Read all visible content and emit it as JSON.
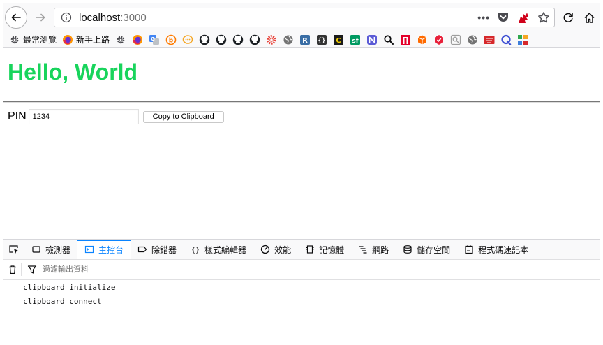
{
  "browser": {
    "url_host": "localhost",
    "url_port": ":3000"
  },
  "bookmarks": [
    {
      "name": "most-visited",
      "label": "最常瀏覽",
      "icon": "gear-icon",
      "color": "#4a4a4f"
    },
    {
      "name": "getting-started",
      "label": "新手上路",
      "icon": "firefox-icon",
      "color": "#e66000"
    },
    {
      "name": "settings",
      "label": "",
      "icon": "gear-icon",
      "color": "#4a4a4f"
    },
    {
      "name": "firefox",
      "label": "",
      "icon": "firefox-icon",
      "color": "#e66000"
    },
    {
      "name": "translate",
      "label": "",
      "icon": "translate-icon",
      "color": "#4285f4"
    },
    {
      "name": "b-site",
      "label": "",
      "icon": "b-icon",
      "color": "#ff7b00"
    },
    {
      "name": "chat",
      "label": "",
      "icon": "chat-icon",
      "color": "#f5a623"
    },
    {
      "name": "github-1",
      "label": "",
      "icon": "github-icon",
      "color": "#1b1f23"
    },
    {
      "name": "github-2",
      "label": "",
      "icon": "github-icon",
      "color": "#1b1f23"
    },
    {
      "name": "github-3",
      "label": "",
      "icon": "github-icon",
      "color": "#1b1f23"
    },
    {
      "name": "github-4",
      "label": "",
      "icon": "github-icon",
      "color": "#1b1f23"
    },
    {
      "name": "gear-red",
      "label": "",
      "icon": "gear-red-icon",
      "color": "#e8453c"
    },
    {
      "name": "globe-1",
      "label": "",
      "icon": "globe-icon",
      "color": "#737373"
    },
    {
      "name": "r-site",
      "label": "",
      "icon": "r-icon",
      "color": "#3a6ea5"
    },
    {
      "name": "braces",
      "label": "",
      "icon": "braces-icon",
      "color": "#333333"
    },
    {
      "name": "c-site",
      "label": "",
      "icon": "c-icon",
      "color": "#1b1b1b"
    },
    {
      "name": "sf-site",
      "label": "",
      "icon": "sf-icon",
      "color": "#009a61"
    },
    {
      "name": "n-site",
      "label": "",
      "icon": "n-icon",
      "color": "#5b5bd6"
    },
    {
      "name": "search",
      "label": "",
      "icon": "search-icon",
      "color": "#0c0c0d"
    },
    {
      "name": "red-square",
      "label": "",
      "icon": "red-square-icon",
      "color": "#e4002b"
    },
    {
      "name": "orange-cube",
      "label": "",
      "icon": "cube-icon",
      "color": "#ff6a00"
    },
    {
      "name": "red-shield",
      "label": "",
      "icon": "shield-icon",
      "color": "#e8203a"
    },
    {
      "name": "grey-search",
      "label": "",
      "icon": "search-box-icon",
      "color": "#9e9e9e"
    },
    {
      "name": "globe-2",
      "label": "",
      "icon": "globe-icon",
      "color": "#737373"
    },
    {
      "name": "red-chinese",
      "label": "",
      "icon": "red-badge-icon",
      "color": "#d6282b"
    },
    {
      "name": "q-site",
      "label": "",
      "icon": "q-icon",
      "color": "#3d4fd3"
    },
    {
      "name": "grid-site",
      "label": "",
      "icon": "grid-icon",
      "color": "#2fa84f"
    }
  ],
  "page": {
    "heading": "Hello, World",
    "heading_color": "#18d45c",
    "pin_label": "PIN",
    "pin_value": "1234",
    "copy_button": "Copy to Clipboard"
  },
  "devtools": {
    "tabs": [
      {
        "label": "檢測器",
        "icon": "inspector-icon"
      },
      {
        "label": "主控台",
        "icon": "console-icon",
        "active": true
      },
      {
        "label": "除錯器",
        "icon": "debugger-icon"
      },
      {
        "label": "樣式編輯器",
        "icon": "style-editor-icon"
      },
      {
        "label": "效能",
        "icon": "performance-icon"
      },
      {
        "label": "記憶體",
        "icon": "memory-icon"
      },
      {
        "label": "網路",
        "icon": "network-icon"
      },
      {
        "label": "儲存空間",
        "icon": "storage-icon"
      },
      {
        "label": "程式碼速記本",
        "icon": "scratchpad-icon"
      }
    ],
    "filter_placeholder": "過濾輸出資料",
    "console_lines": [
      "clipboard initialize",
      "clipboard connect"
    ],
    "accent_color": "#0a84ff"
  }
}
